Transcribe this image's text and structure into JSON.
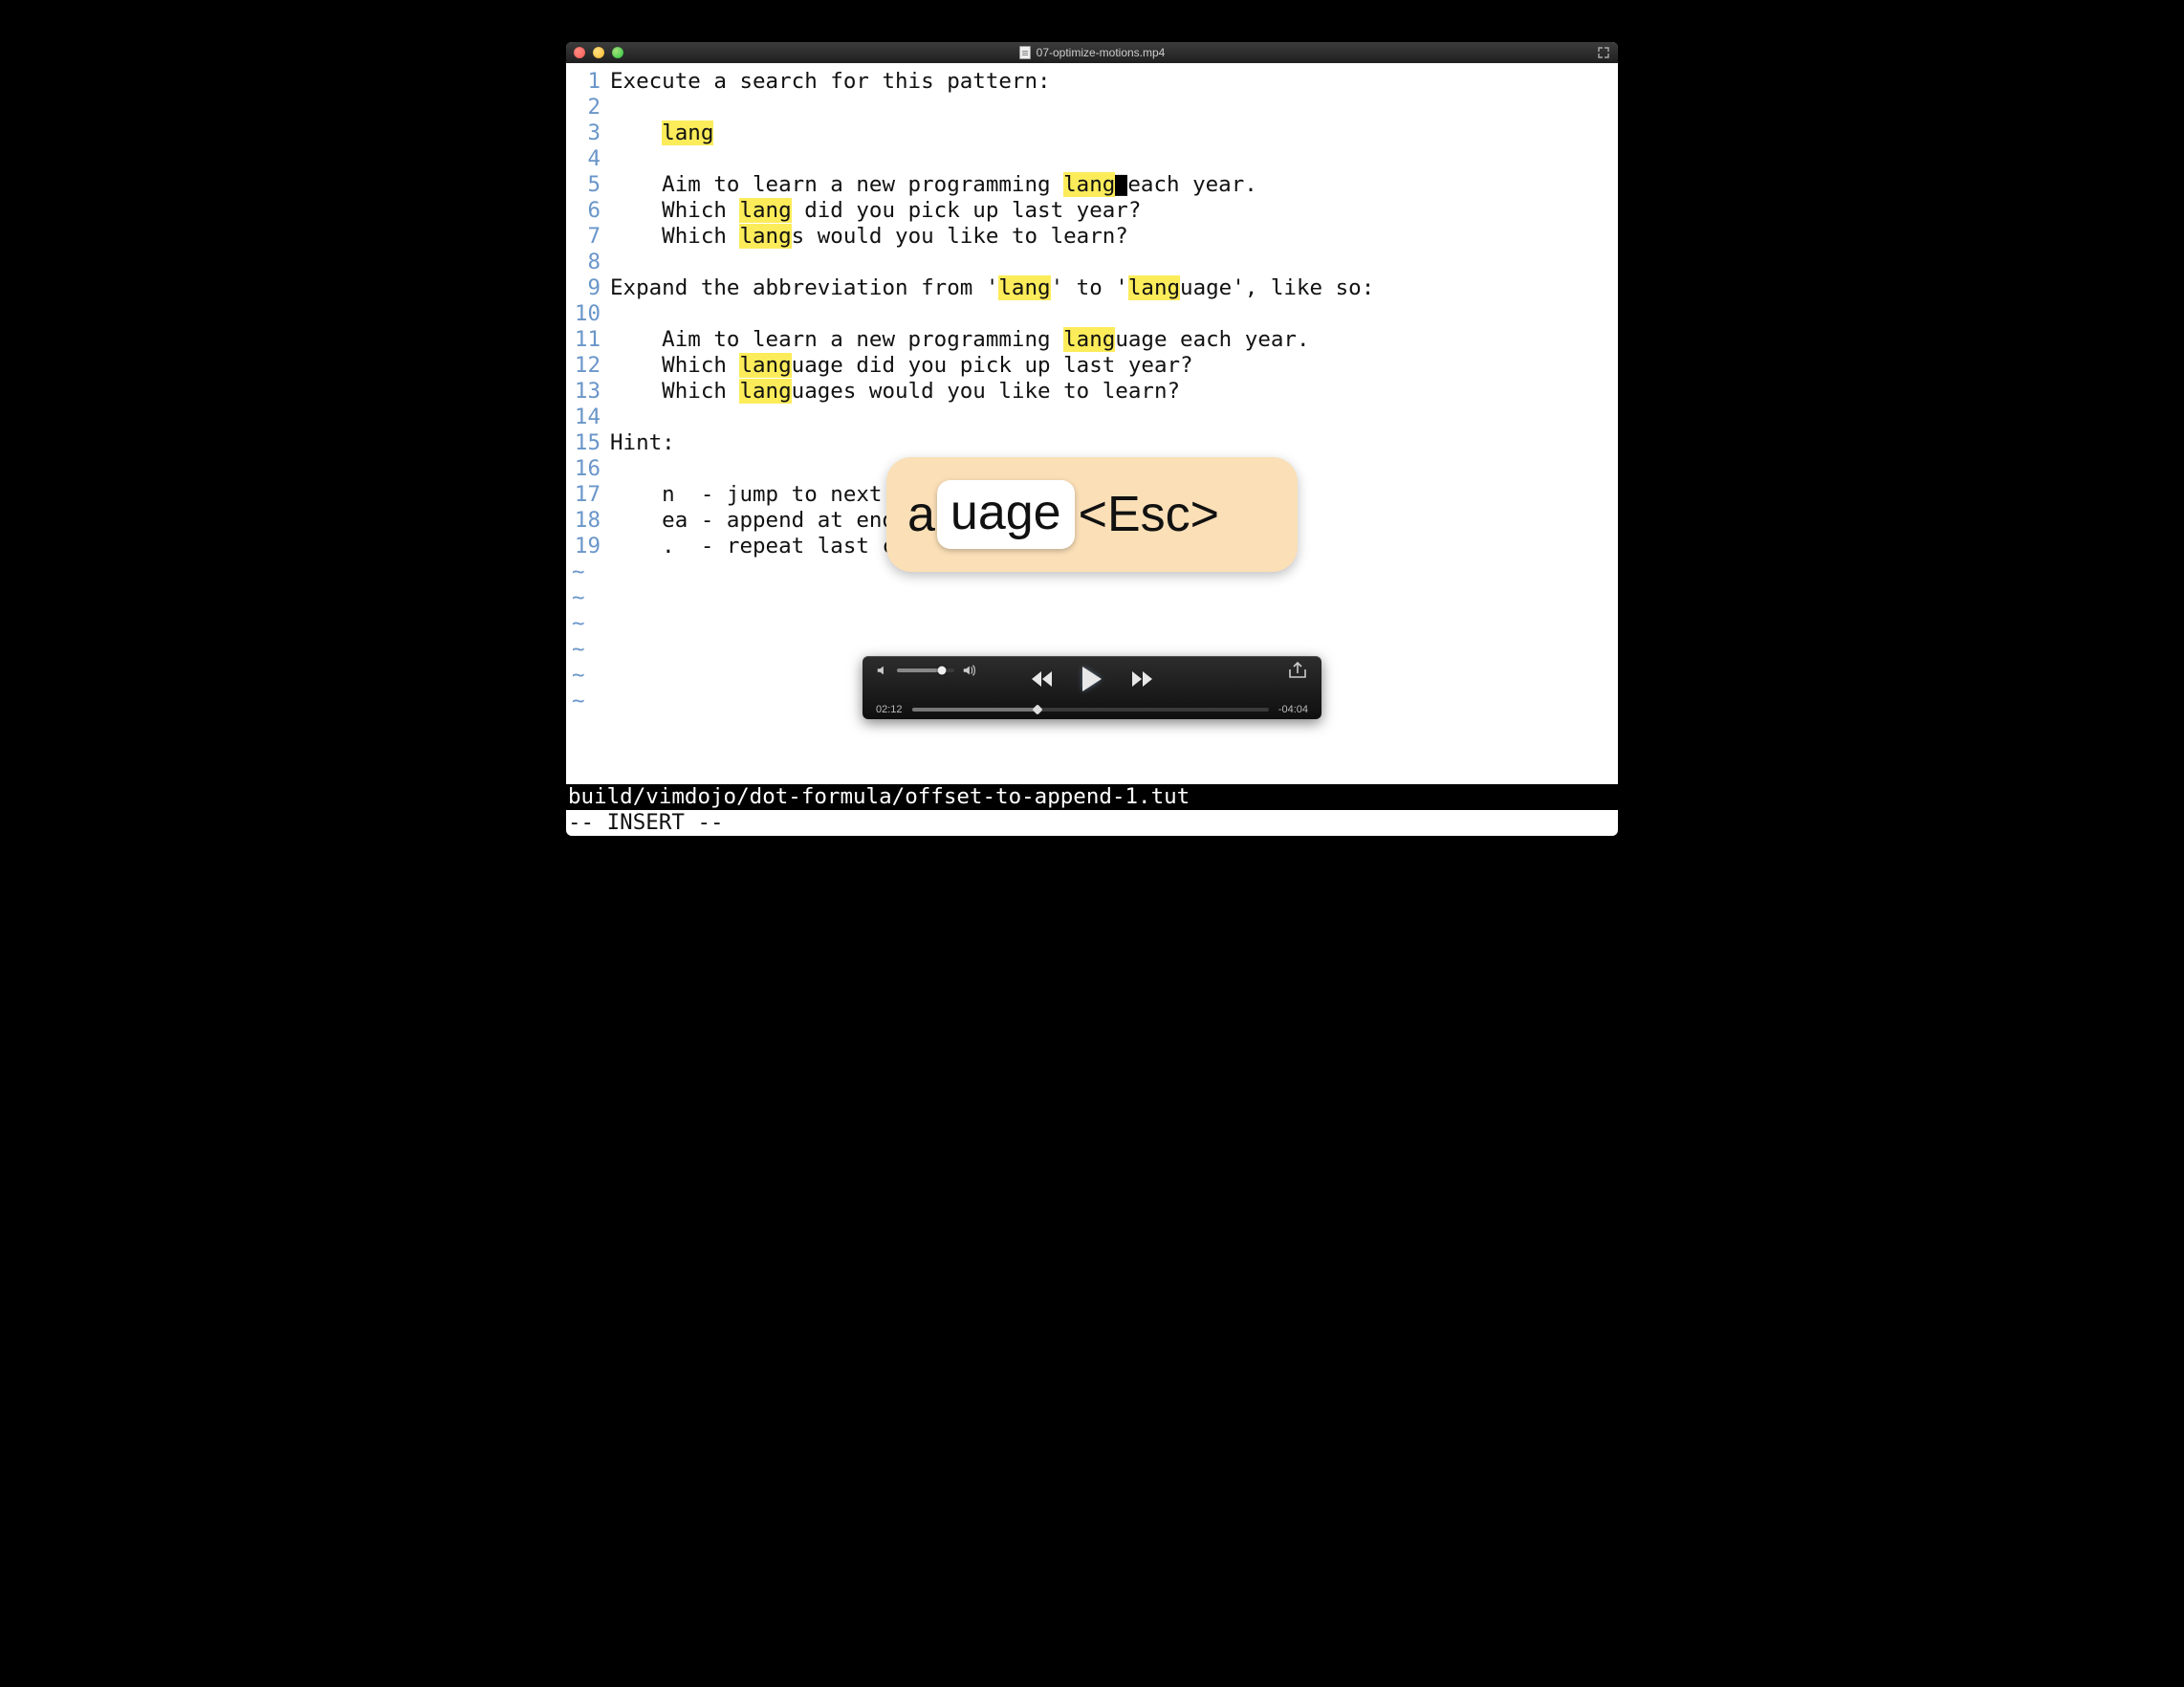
{
  "window": {
    "title": "07-optimize-motions.mp4"
  },
  "editor": {
    "highlight": "lang",
    "lines": [
      {
        "num": "1",
        "text": "Execute a search for this pattern:",
        "indent": ""
      },
      {
        "num": "2",
        "text": "",
        "indent": ""
      },
      {
        "num": "3",
        "text": "lang",
        "indent": "    "
      },
      {
        "num": "4",
        "text": "",
        "indent": ""
      },
      {
        "num": "5",
        "text": "Aim to learn a new programming lang each year.",
        "indent": "    ",
        "cursor_after_hl": true
      },
      {
        "num": "6",
        "text": "Which lang did you pick up last year?",
        "indent": "    "
      },
      {
        "num": "7",
        "text": "Which langs would you like to learn?",
        "indent": "    "
      },
      {
        "num": "8",
        "text": "",
        "indent": ""
      },
      {
        "num": "9",
        "text": "Expand the abbreviation from 'lang' to 'language', like so:",
        "indent": ""
      },
      {
        "num": "10",
        "text": "",
        "indent": ""
      },
      {
        "num": "11",
        "text": "Aim to learn a new programming language each year.",
        "indent": "    "
      },
      {
        "num": "12",
        "text": "Which language did you pick up last year?",
        "indent": "    "
      },
      {
        "num": "13",
        "text": "Which languages would you like to learn?",
        "indent": "    "
      },
      {
        "num": "14",
        "text": "",
        "indent": ""
      },
      {
        "num": "15",
        "text": "Hint:",
        "indent": ""
      },
      {
        "num": "16",
        "text": "",
        "indent": ""
      },
      {
        "num": "17",
        "text": "n  - jump to next ",
        "indent": "    "
      },
      {
        "num": "18",
        "text": "ea - append at end",
        "indent": "    "
      },
      {
        "num": "19",
        "text": ".  - repeat last c",
        "indent": "    "
      }
    ],
    "tilde": "~",
    "tilde_count": 6,
    "statusbar": "build/vimdojo/dot-formula/offset-to-append-1.tut",
    "mode": "-- INSERT --"
  },
  "overlay": {
    "prefix": "a",
    "keycap": "uage",
    "suffix": "<Esc>"
  },
  "player": {
    "elapsed": "02:12",
    "remaining": "-04:04",
    "volume_pct": 78,
    "progress_pct": 35.1
  }
}
